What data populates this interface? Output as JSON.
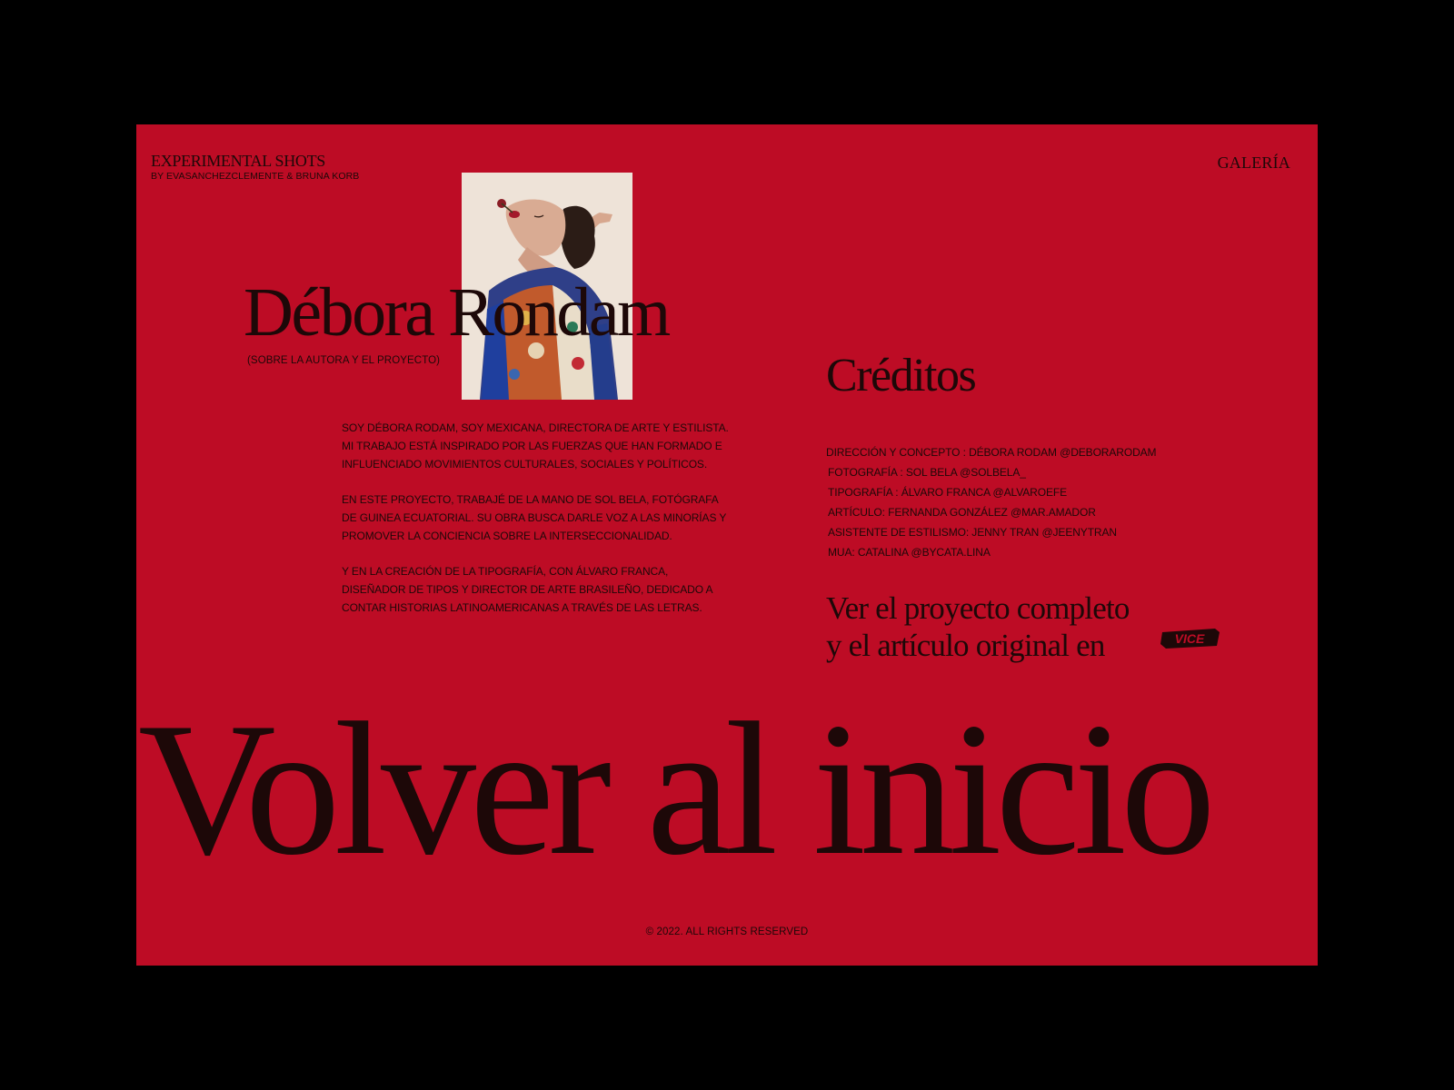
{
  "header": {
    "brand_title": "EXPERIMENTAL SHOTS",
    "brand_subtitle": "BY EVASANCHEZCLEMENTE & BRUNA KORB",
    "nav_gallery": "GALERÍA"
  },
  "author": {
    "name": "Débora Rondam",
    "subtitle": "(SOBRE LA AUTORA Y EL PROYECTO)",
    "bio": [
      "SOY DÉBORA RODAM, SOY MEXICANA, DIRECTORA DE ARTE Y ESTILISTA. MI TRABAJO ESTÁ INSPIRADO POR LAS FUERZAS QUE HAN FORMADO E INFLUENCIADO MOVIMIENTOS CULTURALES, SOCIALES Y POLÍTICOS.",
      "EN ESTE PROYECTO, TRABAJÉ DE LA MANO DE SOL BELA, FOTÓGRAFA DE GUINEA ECUATORIAL. SU OBRA BUSCA DARLE VOZ A LAS MINORÍAS Y PROMOVER LA CONCIENCIA SOBRE LA INTERSECCIONALIDAD.",
      "Y EN LA CREACIÓN DE LA TIPOGRAFÍA, CON ÁLVARO FRANCA, DISEÑADOR DE TIPOS Y DIRECTOR DE ARTE BRASILEÑO, DEDICADO A CONTAR HISTORIAS LATINOAMERICANAS A TRAVÉS DE LAS LETRAS."
    ]
  },
  "credits": {
    "title": "Créditos",
    "items": [
      "DIRECCIÓN Y CONCEPTO : DÉBORA RODAM @DEBORARODAM",
      "FOTOGRAFÍA : SOL BELA @SOLBELA_",
      "TIPOGRAFÍA : ÁLVARO FRANCA @ALVAROEFE",
      "ARTÍCULO: FERNANDA GONZÁLEZ @MAR.AMADOR",
      "ASISTENTE DE ESTILISMO: JENNY TRAN @JEENYTRAN",
      "MUA: CATALINA @BYCATA.LINA"
    ],
    "project_line_1": "Ver el proyecto completo",
    "project_line_2": "y el artículo original en",
    "vice_logo_text": "VICE"
  },
  "back_link": "Volver al inicio",
  "footer": "© 2022. ALL RIGHTS RESERVED",
  "colors": {
    "background": "#000000",
    "page": "#bd0c25",
    "text": "#1d0808"
  }
}
